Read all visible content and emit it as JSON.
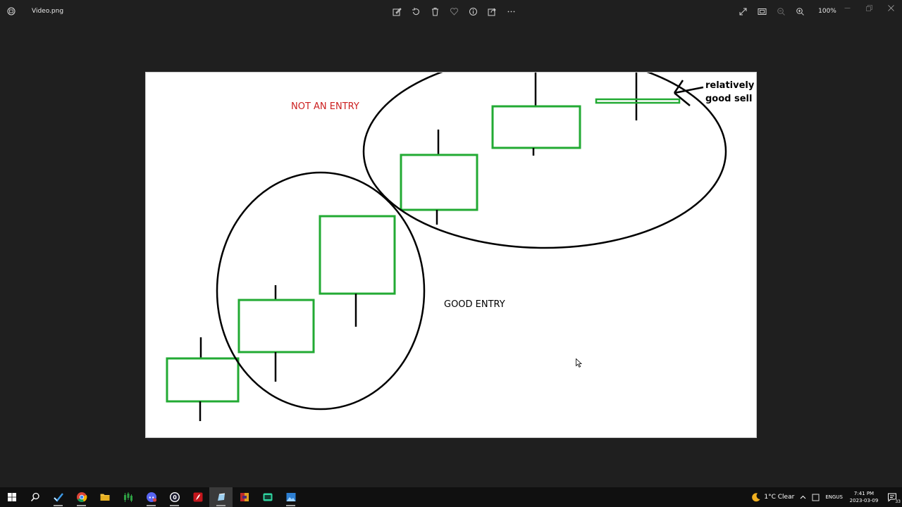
{
  "window": {
    "file_name": "Video.png",
    "zoom_level": "100%",
    "toolbar_icons": [
      "edit-icon",
      "rotate-icon",
      "delete-icon",
      "favorite-icon",
      "info-icon",
      "share-icon",
      "more-icon"
    ],
    "view_icons": [
      "fullscreen-icon",
      "fit-icon",
      "zoom-out-icon",
      "zoom-in-icon"
    ]
  },
  "image": {
    "annotations": {
      "not_entry": "NOT AN ENTRY",
      "good_entry": "GOOD ENTRY",
      "sell_line1": "relatively",
      "sell_line2": "good sell"
    },
    "colors": {
      "candle_green": "#22aa33",
      "not_entry_red": "#cc2020",
      "ink": "#000000"
    }
  },
  "taskbar": {
    "apps": [
      "windows-start-icon",
      "search-icon",
      "tradingview-icon",
      "chrome-icon",
      "file-explorer-icon",
      "tradingview-chart-icon",
      "discord-icon",
      "obs-icon",
      "adobe-icon",
      "paint-icon",
      "winrar-icon",
      "terminal-icon",
      "photos-icon"
    ],
    "weather": "1°C  Clear",
    "lang_top": "ENG",
    "lang_bottom": "US",
    "time": "7:41 PM",
    "date": "2023-03-09",
    "notification_count": "33"
  }
}
